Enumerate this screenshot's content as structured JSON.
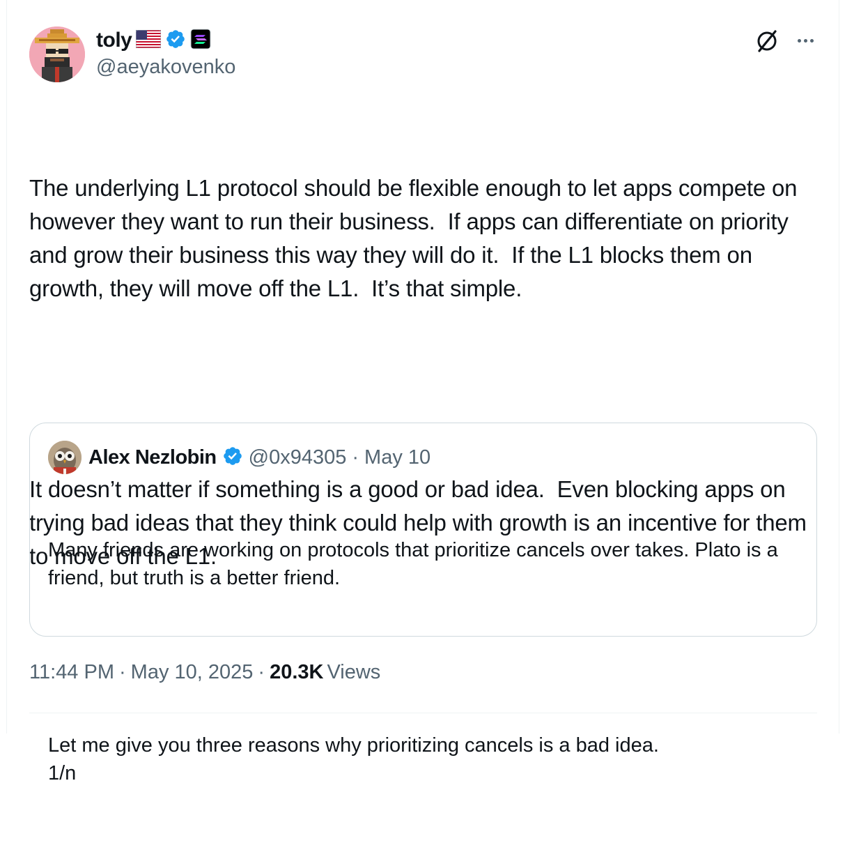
{
  "post": {
    "author_name": "toly",
    "handle": "@aeyakovenko",
    "paragraphs": [
      "The underlying L1 protocol should be flexible enough to let apps compete on however they want to run their business.  If apps can differentiate on priority and grow their business this way they will do it.  If the L1 blocks them on growth, they will move off the L1.  It’s that simple.",
      "It doesn’t matter if something is a good or bad idea.  Even blocking apps on trying bad ideas that they think could help with growth is an incentive for them to move off the L1."
    ],
    "time": "11:44 PM",
    "date": "May 10, 2025",
    "views_count": "20.3K",
    "views_label": "Views",
    "separator": "·"
  },
  "quote": {
    "author_name": "Alex Nezlobin",
    "handle": "@0x94305",
    "separator": "·",
    "date": "May 10",
    "paragraphs": [
      "Many friends are working on protocols that prioritize cancels over takes. Plato is a friend, but truth is a better friend.",
      "Let me give you three reasons why prioritizing cancels is a bad idea.\n1/n"
    ]
  },
  "icons": {
    "flag": "us-flag-icon",
    "verified": "verified-badge-icon",
    "affiliate": "solana-affiliate-icon",
    "grok": "grok-icon",
    "more": "more-icon"
  },
  "colors": {
    "verified_blue": "#1d9bf0",
    "secondary_text": "#536471",
    "primary_text": "#0f1419",
    "border": "#cfd9de"
  }
}
